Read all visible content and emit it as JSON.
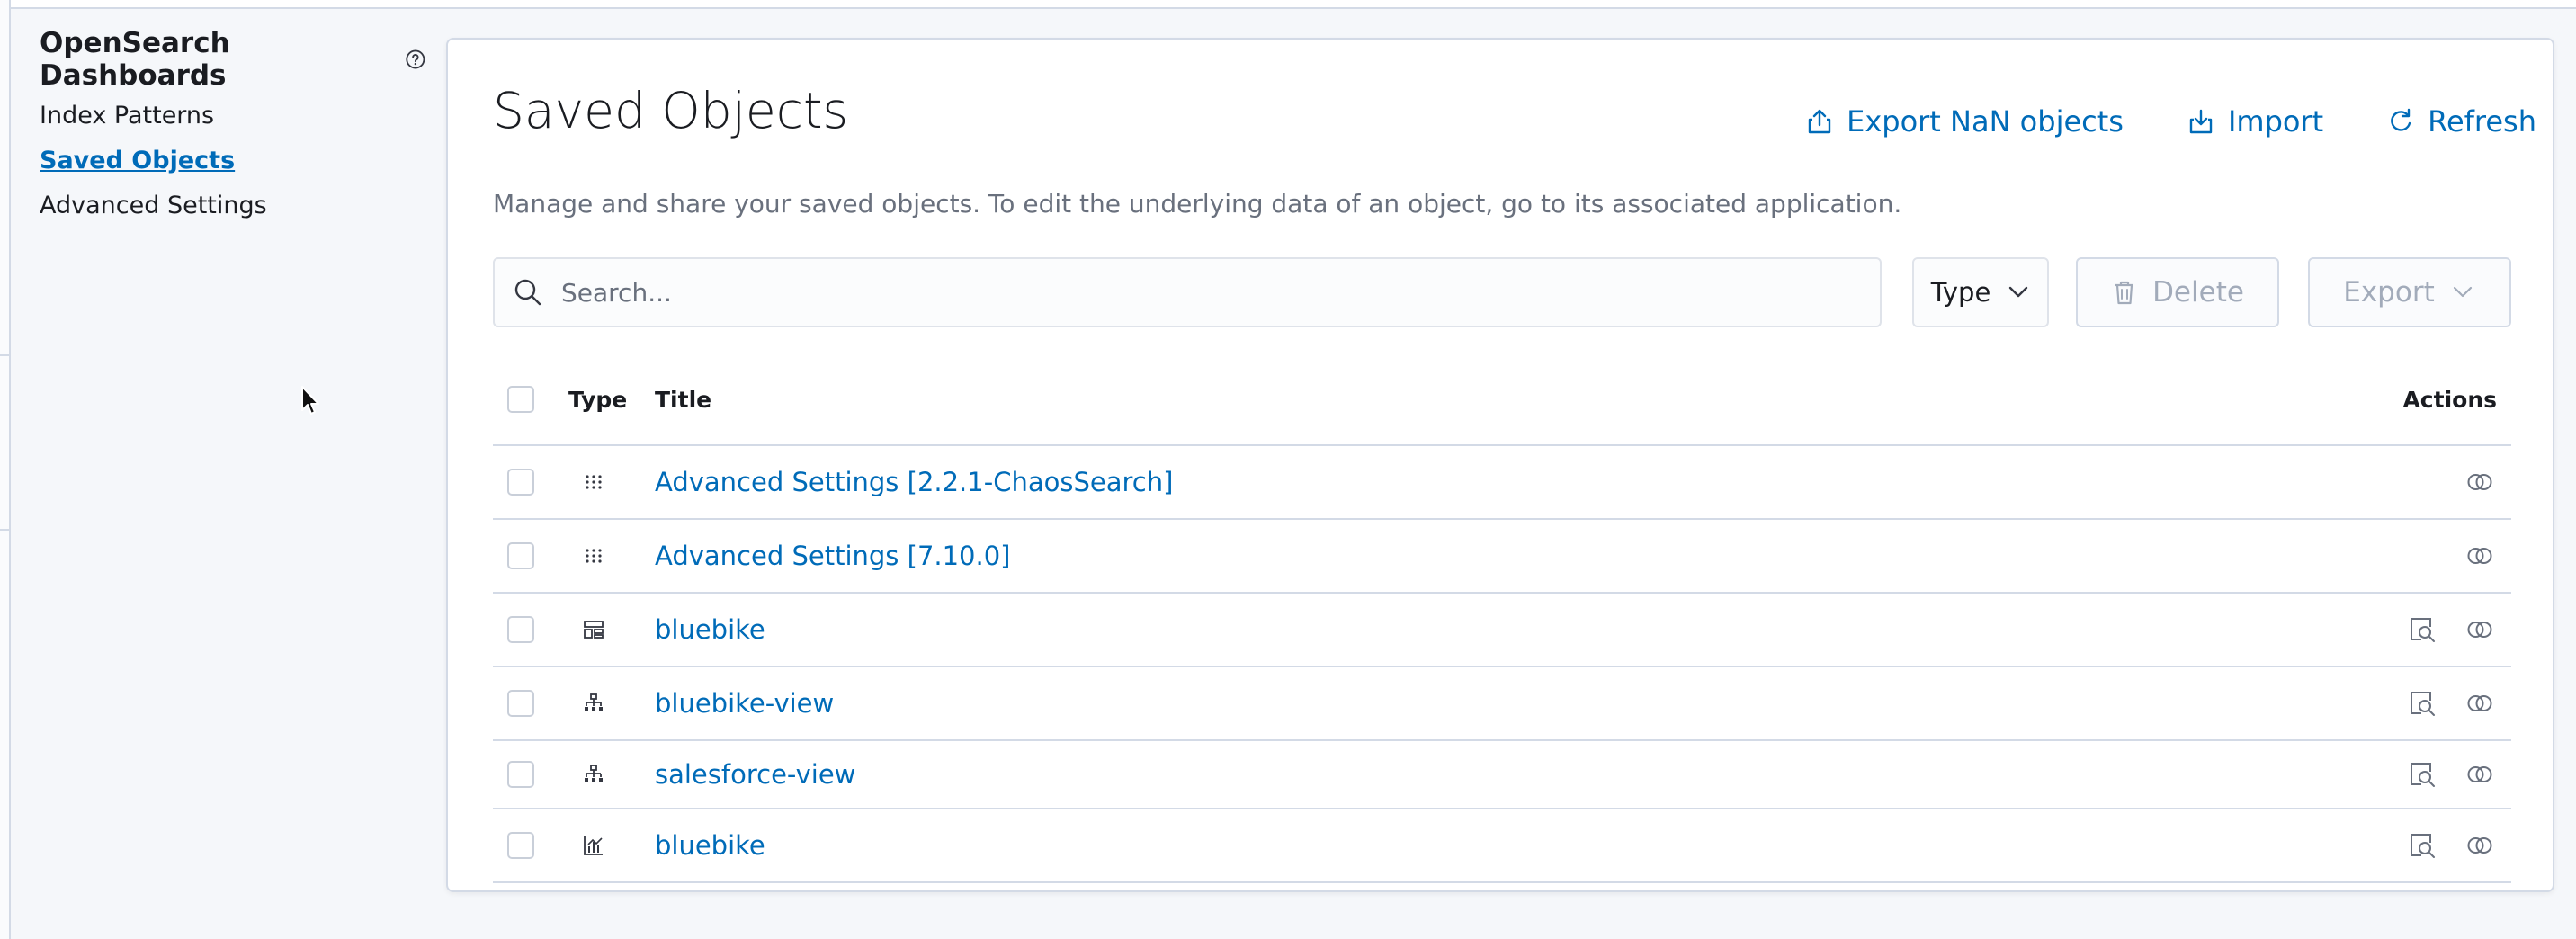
{
  "sidebar": {
    "title": "OpenSearch Dashboards",
    "items": [
      {
        "label": "Index Patterns"
      },
      {
        "label": "Saved Objects"
      },
      {
        "label": "Advanced Settings"
      }
    ]
  },
  "header": {
    "title": "Saved Objects",
    "export_label": "Export NaN objects",
    "import_label": "Import",
    "refresh_label": "Refresh",
    "description": "Manage and share your saved objects. To edit the underlying data of an object, go to its associated application."
  },
  "toolbar": {
    "search_placeholder": "Search...",
    "type_label": "Type",
    "delete_label": "Delete",
    "export_label": "Export"
  },
  "table": {
    "columns": {
      "type": "Type",
      "title": "Title",
      "actions": "Actions"
    },
    "rows": [
      {
        "type_icon": "advanced-settings-icon",
        "title": "Advanced Settings [2.2.1-ChaosSearch]",
        "actions": [
          "relationships"
        ]
      },
      {
        "type_icon": "advanced-settings-icon",
        "title": "Advanced Settings [7.10.0]",
        "actions": [
          "relationships"
        ]
      },
      {
        "type_icon": "dashboard-icon",
        "title": "bluebike",
        "actions": [
          "inspect",
          "relationships"
        ]
      },
      {
        "type_icon": "index-pattern-icon",
        "title": "bluebike-view",
        "actions": [
          "inspect",
          "relationships"
        ]
      },
      {
        "type_icon": "index-pattern-icon",
        "title": "salesforce-view",
        "actions": [
          "inspect",
          "relationships"
        ]
      },
      {
        "type_icon": "visualization-icon",
        "title": "bluebike",
        "actions": [
          "inspect",
          "relationships"
        ]
      }
    ]
  },
  "colors": {
    "link": "#006bb8",
    "text": "#1a1c21",
    "muted": "#69707d",
    "border": "#d3dae6"
  }
}
